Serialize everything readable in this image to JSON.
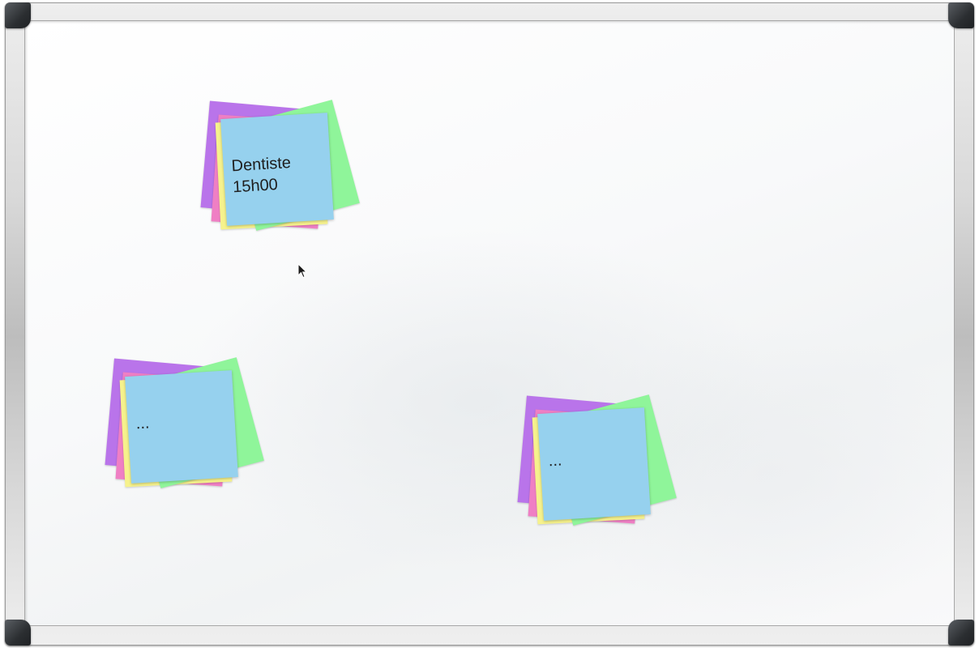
{
  "whiteboard": {
    "surface_color": "#ffffff",
    "frame_color": "#c8c8c8",
    "corner_color": "#2f3236"
  },
  "note_colors": {
    "purple": "#b974ea",
    "pink": "#ef7fc4",
    "yellow": "#f6f28c",
    "green": "#8ff59a",
    "blue": "#96d1ee"
  },
  "stacks": [
    {
      "text": "Dentiste\n15h00"
    },
    {
      "text": "..."
    },
    {
      "text": "..."
    }
  ],
  "cursor": {
    "icon": "mouse-pointer-icon"
  }
}
